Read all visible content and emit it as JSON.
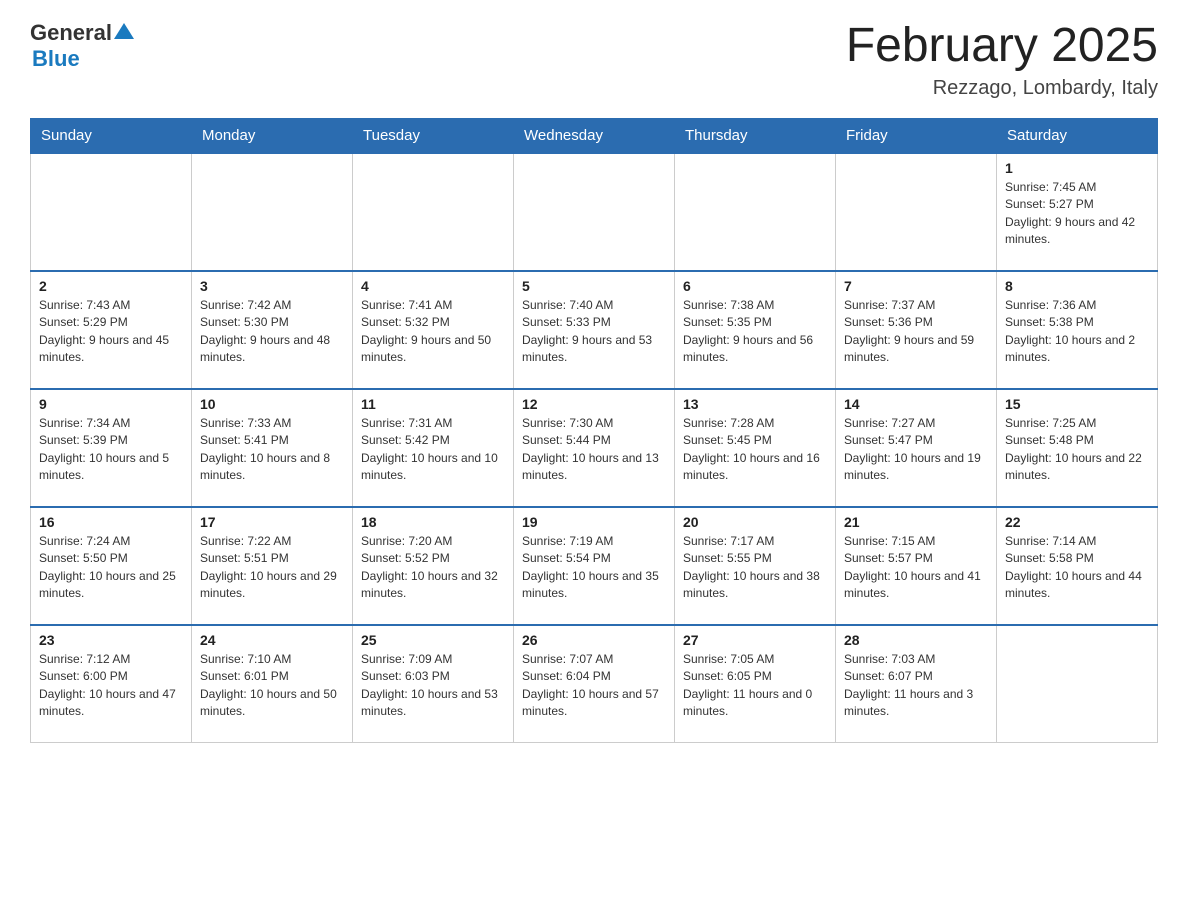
{
  "header": {
    "logo_general": "General",
    "logo_blue": "Blue",
    "month_title": "February 2025",
    "location": "Rezzago, Lombardy, Italy"
  },
  "days_of_week": [
    "Sunday",
    "Monday",
    "Tuesday",
    "Wednesday",
    "Thursday",
    "Friday",
    "Saturday"
  ],
  "weeks": [
    [
      {
        "day": "",
        "info": ""
      },
      {
        "day": "",
        "info": ""
      },
      {
        "day": "",
        "info": ""
      },
      {
        "day": "",
        "info": ""
      },
      {
        "day": "",
        "info": ""
      },
      {
        "day": "",
        "info": ""
      },
      {
        "day": "1",
        "info": "Sunrise: 7:45 AM\nSunset: 5:27 PM\nDaylight: 9 hours and 42 minutes."
      }
    ],
    [
      {
        "day": "2",
        "info": "Sunrise: 7:43 AM\nSunset: 5:29 PM\nDaylight: 9 hours and 45 minutes."
      },
      {
        "day": "3",
        "info": "Sunrise: 7:42 AM\nSunset: 5:30 PM\nDaylight: 9 hours and 48 minutes."
      },
      {
        "day": "4",
        "info": "Sunrise: 7:41 AM\nSunset: 5:32 PM\nDaylight: 9 hours and 50 minutes."
      },
      {
        "day": "5",
        "info": "Sunrise: 7:40 AM\nSunset: 5:33 PM\nDaylight: 9 hours and 53 minutes."
      },
      {
        "day": "6",
        "info": "Sunrise: 7:38 AM\nSunset: 5:35 PM\nDaylight: 9 hours and 56 minutes."
      },
      {
        "day": "7",
        "info": "Sunrise: 7:37 AM\nSunset: 5:36 PM\nDaylight: 9 hours and 59 minutes."
      },
      {
        "day": "8",
        "info": "Sunrise: 7:36 AM\nSunset: 5:38 PM\nDaylight: 10 hours and 2 minutes."
      }
    ],
    [
      {
        "day": "9",
        "info": "Sunrise: 7:34 AM\nSunset: 5:39 PM\nDaylight: 10 hours and 5 minutes."
      },
      {
        "day": "10",
        "info": "Sunrise: 7:33 AM\nSunset: 5:41 PM\nDaylight: 10 hours and 8 minutes."
      },
      {
        "day": "11",
        "info": "Sunrise: 7:31 AM\nSunset: 5:42 PM\nDaylight: 10 hours and 10 minutes."
      },
      {
        "day": "12",
        "info": "Sunrise: 7:30 AM\nSunset: 5:44 PM\nDaylight: 10 hours and 13 minutes."
      },
      {
        "day": "13",
        "info": "Sunrise: 7:28 AM\nSunset: 5:45 PM\nDaylight: 10 hours and 16 minutes."
      },
      {
        "day": "14",
        "info": "Sunrise: 7:27 AM\nSunset: 5:47 PM\nDaylight: 10 hours and 19 minutes."
      },
      {
        "day": "15",
        "info": "Sunrise: 7:25 AM\nSunset: 5:48 PM\nDaylight: 10 hours and 22 minutes."
      }
    ],
    [
      {
        "day": "16",
        "info": "Sunrise: 7:24 AM\nSunset: 5:50 PM\nDaylight: 10 hours and 25 minutes."
      },
      {
        "day": "17",
        "info": "Sunrise: 7:22 AM\nSunset: 5:51 PM\nDaylight: 10 hours and 29 minutes."
      },
      {
        "day": "18",
        "info": "Sunrise: 7:20 AM\nSunset: 5:52 PM\nDaylight: 10 hours and 32 minutes."
      },
      {
        "day": "19",
        "info": "Sunrise: 7:19 AM\nSunset: 5:54 PM\nDaylight: 10 hours and 35 minutes."
      },
      {
        "day": "20",
        "info": "Sunrise: 7:17 AM\nSunset: 5:55 PM\nDaylight: 10 hours and 38 minutes."
      },
      {
        "day": "21",
        "info": "Sunrise: 7:15 AM\nSunset: 5:57 PM\nDaylight: 10 hours and 41 minutes."
      },
      {
        "day": "22",
        "info": "Sunrise: 7:14 AM\nSunset: 5:58 PM\nDaylight: 10 hours and 44 minutes."
      }
    ],
    [
      {
        "day": "23",
        "info": "Sunrise: 7:12 AM\nSunset: 6:00 PM\nDaylight: 10 hours and 47 minutes."
      },
      {
        "day": "24",
        "info": "Sunrise: 7:10 AM\nSunset: 6:01 PM\nDaylight: 10 hours and 50 minutes."
      },
      {
        "day": "25",
        "info": "Sunrise: 7:09 AM\nSunset: 6:03 PM\nDaylight: 10 hours and 53 minutes."
      },
      {
        "day": "26",
        "info": "Sunrise: 7:07 AM\nSunset: 6:04 PM\nDaylight: 10 hours and 57 minutes."
      },
      {
        "day": "27",
        "info": "Sunrise: 7:05 AM\nSunset: 6:05 PM\nDaylight: 11 hours and 0 minutes."
      },
      {
        "day": "28",
        "info": "Sunrise: 7:03 AM\nSunset: 6:07 PM\nDaylight: 11 hours and 3 minutes."
      },
      {
        "day": "",
        "info": ""
      }
    ]
  ]
}
